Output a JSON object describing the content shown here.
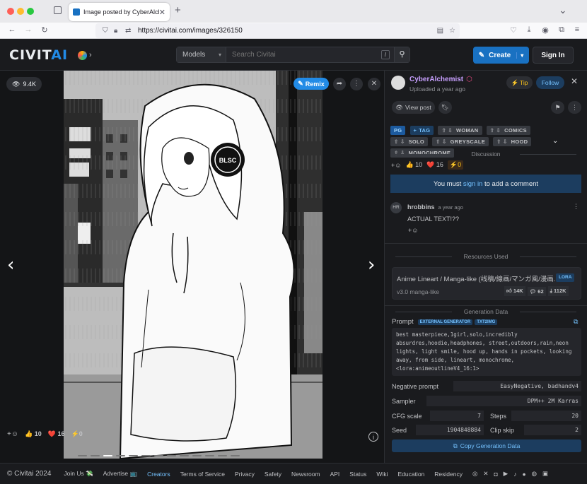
{
  "browser": {
    "tab_title": "Image posted by CyberAlchemist",
    "url": "https://civitai.com/images/326150",
    "new_tab": "+",
    "chevron": "⌄"
  },
  "header": {
    "logo_a": "CIVIT",
    "logo_b": "AI",
    "models_label": "Models",
    "search_placeholder": "Search Civitai",
    "search_shortcut": "/",
    "create_label": "Create",
    "login_label": "Sign In"
  },
  "viewer": {
    "views": "9.4K",
    "remix_label": "Remix",
    "reactions": {
      "plus": "+☺",
      "like": "10",
      "heart": "16",
      "bolt": "0"
    },
    "headphone_text": "BLSC"
  },
  "post": {
    "author": "CyberAlchemist",
    "uploaded": "Uploaded a year ago",
    "tip_label": "Tip",
    "follow_label": "Follow",
    "view_post_label": "View post",
    "rating": "PG",
    "add_tag": "TAG",
    "tags": [
      "WOMAN",
      "COMICS",
      "SOLO",
      "GREYSCALE",
      "HOOD",
      "MONOCHROME"
    ]
  },
  "discussion": {
    "title": "Discussion",
    "reactions": {
      "like": "10",
      "heart": "16",
      "bolt": "0"
    },
    "signin_prefix": "You must",
    "signin_link": "sign in",
    "signin_suffix": "to add a comment",
    "comment": {
      "initials": "HR",
      "user": "hrobbins",
      "time": "a year ago",
      "text": "ACTUAL TEXT!??"
    }
  },
  "resources": {
    "title": "Resources Used",
    "name": "Anime Lineart / Manga-like (线稿/線画/マンガ風/漫画...",
    "type": "LORA",
    "version": "v3.0 manga-like",
    "likes": "14K",
    "comments": "62",
    "downloads": "112K"
  },
  "generation": {
    "title": "Generation Data",
    "prompt_label": "Prompt",
    "badge1": "EXTERNAL GENERATOR",
    "badge2": "TXT2IMG",
    "prompt": "best masterpiece,1girl,solo,incredibly absurdres,hoodie,headphones, street,outdoors,rain,neon lights, light smile, hood up, hands in pockets, looking away, from side, lineart, monochrome, <lora:animeoutlineV4_16:1>",
    "negative_label": "Negative prompt",
    "negative": "EasyNegative, badhandv4",
    "sampler_label": "Sampler",
    "sampler": "DPM++ 2M Karras",
    "cfg_label": "CFG scale",
    "cfg": "7",
    "steps_label": "Steps",
    "steps": "20",
    "seed_label": "Seed",
    "seed": "1904848884",
    "clip_label": "Clip skip",
    "clip": "2",
    "copy_label": "Copy Generation Data"
  },
  "footer": {
    "copyright": "© Civitai 2024",
    "links": [
      "Join Us 💸",
      "Advertise 📺",
      "Creators",
      "Terms of Service",
      "Privacy",
      "Safety",
      "Newsroom",
      "API",
      "Status",
      "Wiki",
      "Education",
      "Residency"
    ]
  }
}
